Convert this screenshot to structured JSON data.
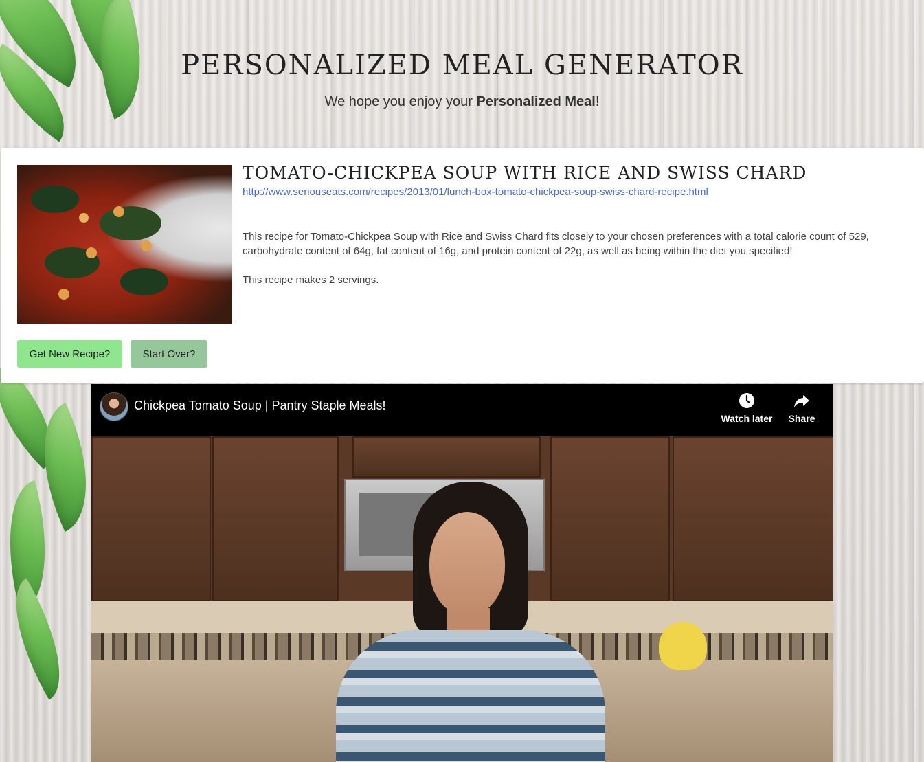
{
  "header": {
    "title": "PERSONALIZED MEAL GENERATOR",
    "subtitle_prefix": "We hope you enjoy your ",
    "subtitle_bold": "Personalized Meal",
    "subtitle_suffix": "!"
  },
  "recipe": {
    "title": "TOMATO-CHICKPEA SOUP WITH RICE AND SWISS CHARD",
    "url": "http://www.seriouseats.com/recipes/2013/01/lunch-box-tomato-chickpea-soup-swiss-chard-recipe.html",
    "description": "This recipe for Tomato-Chickpea Soup with Rice and Swiss Chard fits closely to your chosen preferences with a total calorie count of 529, carbohydrate content of 64g, fat content of 16g, and protein content of 22g, as well as being within the diet you specified!",
    "servings": "This recipe makes 2 servings."
  },
  "buttons": {
    "new_recipe": "Get New Recipe?",
    "start_over": "Start Over?"
  },
  "video": {
    "title": "Chickpea Tomato Soup | Pantry Staple Meals!",
    "watch_later": "Watch later",
    "share": "Share"
  },
  "colors": {
    "new_button": "#8fe68e",
    "start_over_button": "#96c79a",
    "link": "#4a6ec7"
  }
}
